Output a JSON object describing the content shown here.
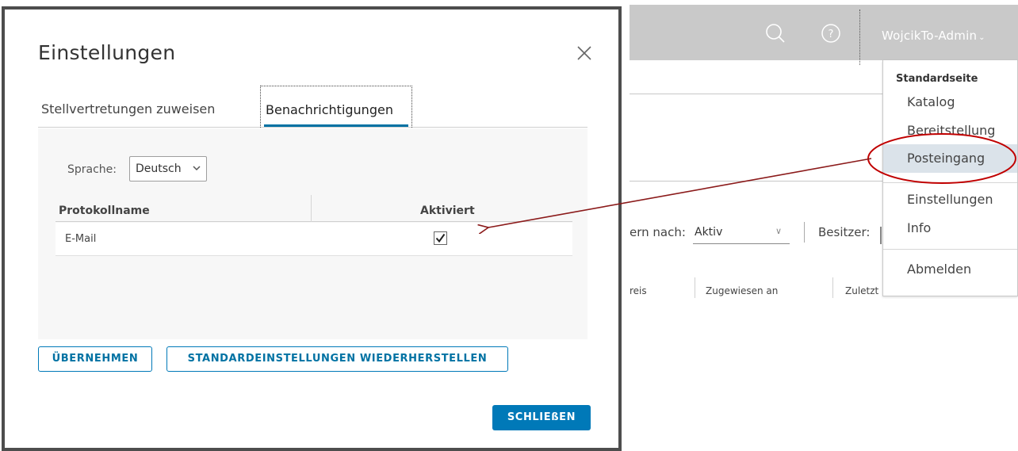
{
  "dialog": {
    "title": "Einstellungen",
    "tabs": [
      {
        "label": "Stellvertretungen zuweisen",
        "active": false
      },
      {
        "label": "Benachrichtigungen",
        "active": true
      }
    ],
    "language": {
      "label": "Sprache:",
      "value": "Deutsch"
    },
    "table": {
      "columns": [
        "Protokollname",
        "Aktiviert"
      ],
      "rows": [
        {
          "name": "E-Mail",
          "enabled": true
        }
      ]
    },
    "buttons": {
      "apply": "ÜBERNEHMEN",
      "reset": "STANDARDEINSTELLUNGEN WIEDERHERSTELLEN",
      "close": "SCHLIEßEN"
    }
  },
  "background": {
    "user": "WojcikTo-Admin",
    "filter": {
      "label": "ern nach:",
      "value": "Aktiv"
    },
    "owner_label": "Besitzer:",
    "columns": [
      "reis",
      "Zugewiesen an",
      "Zuletzt"
    ]
  },
  "dropdown": {
    "header": "Standardseite",
    "items": [
      "Katalog",
      "Bereitstellung",
      "Posteingang",
      "Einstellungen",
      "Info",
      "Abmelden"
    ],
    "highlighted": "Posteingang"
  },
  "colors": {
    "accent": "#0079b8",
    "annotation": "#c00000",
    "arrow": "#8b1a1a",
    "header_bg": "#c9c9c9"
  }
}
